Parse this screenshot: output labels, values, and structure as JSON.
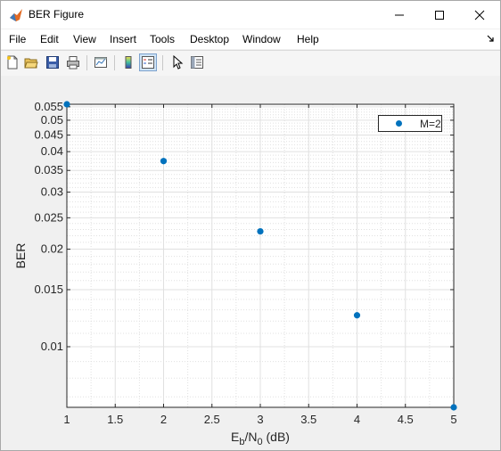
{
  "window": {
    "title": "BER Figure",
    "controls": {
      "minimize": "minimize",
      "maximize": "maximize",
      "close": "close"
    }
  },
  "menubar": {
    "items": [
      "File",
      "Edit",
      "View",
      "Insert",
      "Tools",
      "Desktop",
      "Window",
      "Help"
    ]
  },
  "toolbar": {
    "buttons": [
      "new-figure-icon",
      "open-file-icon",
      "save-icon",
      "print-icon",
      "link-plot-icon",
      "colorbar-icon",
      "legend-icon",
      "pointer-icon",
      "property-editor-icon"
    ]
  },
  "colors": {
    "series": "#0072bd",
    "axes": "#262626",
    "grid": "#e0e0e0"
  },
  "chart_data": {
    "type": "scatter",
    "xlabel_base": "E",
    "xlabel_sub1": "b",
    "xlabel_mid": "/N",
    "xlabel_sub2": "0",
    "xlabel_tail": " (dB)",
    "ylabel": "BER",
    "xlim": [
      1,
      5
    ],
    "ylim": [
      0.0065,
      0.056
    ],
    "yscale": "log",
    "grid": true,
    "legend_position": "top-right",
    "x_ticks": [
      "1",
      "1.5",
      "2",
      "2.5",
      "3",
      "3.5",
      "4",
      "4.5",
      "5"
    ],
    "y_ticks": [
      "0.01",
      "0.015",
      "0.02",
      "0.025",
      "0.03",
      "0.035",
      "0.04",
      "0.045",
      "0.05",
      "0.055"
    ],
    "series": [
      {
        "name": "M=2",
        "x": [
          1,
          2,
          3,
          4,
          5
        ],
        "y": [
          0.056,
          0.0374,
          0.0227,
          0.0125,
          0.0065
        ]
      }
    ]
  }
}
